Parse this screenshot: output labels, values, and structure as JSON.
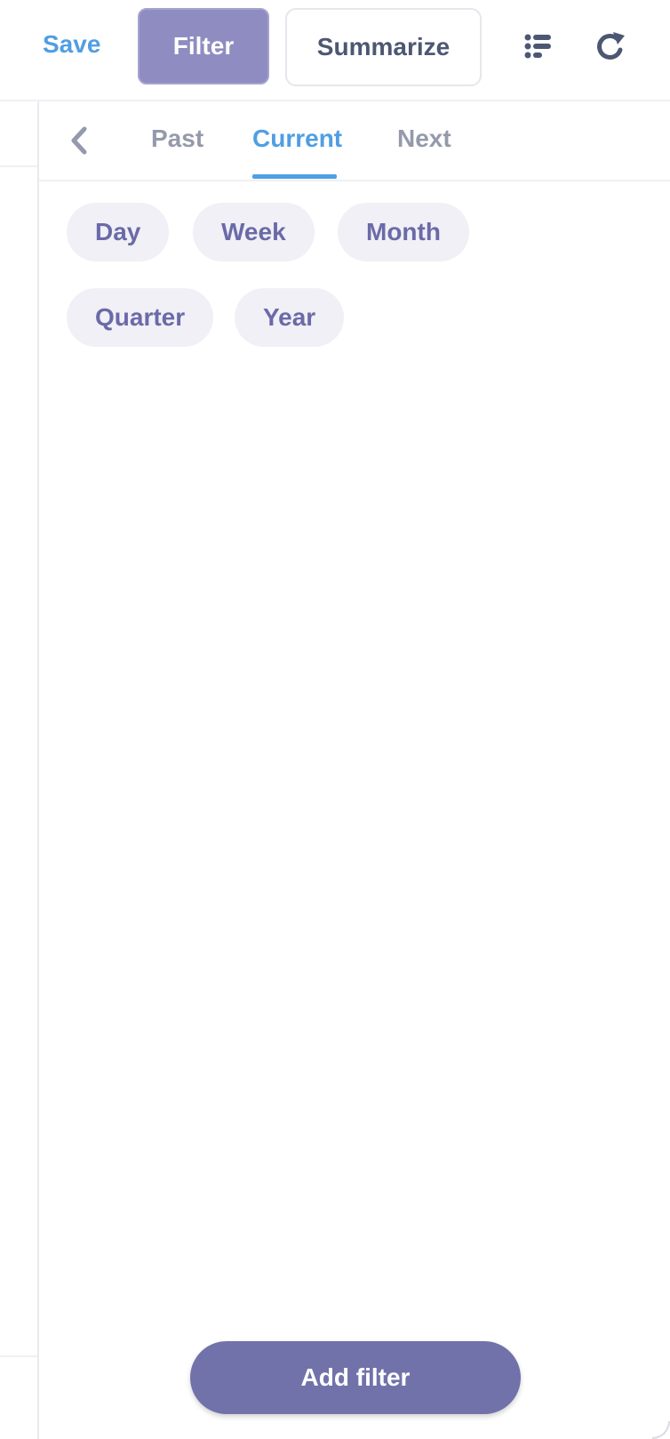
{
  "toolbar": {
    "save_label": "Save",
    "filter_label": "Filter",
    "summarize_label": "Summarize",
    "list_icon": "list-icon",
    "refresh_icon": "refresh-icon"
  },
  "panel": {
    "tabs": [
      {
        "label": "Past",
        "active": false
      },
      {
        "label": "Current",
        "active": true
      },
      {
        "label": "Next",
        "active": false
      }
    ],
    "options": [
      "Day",
      "Week",
      "Month",
      "Quarter",
      "Year"
    ],
    "add_filter_label": "Add filter"
  },
  "colors": {
    "accent": "#509ee3",
    "filter_active": "#8e8cc0",
    "brand": "#7172aa",
    "pill_bg": "#f0f0f6",
    "pill_text": "#6b6aa8"
  }
}
